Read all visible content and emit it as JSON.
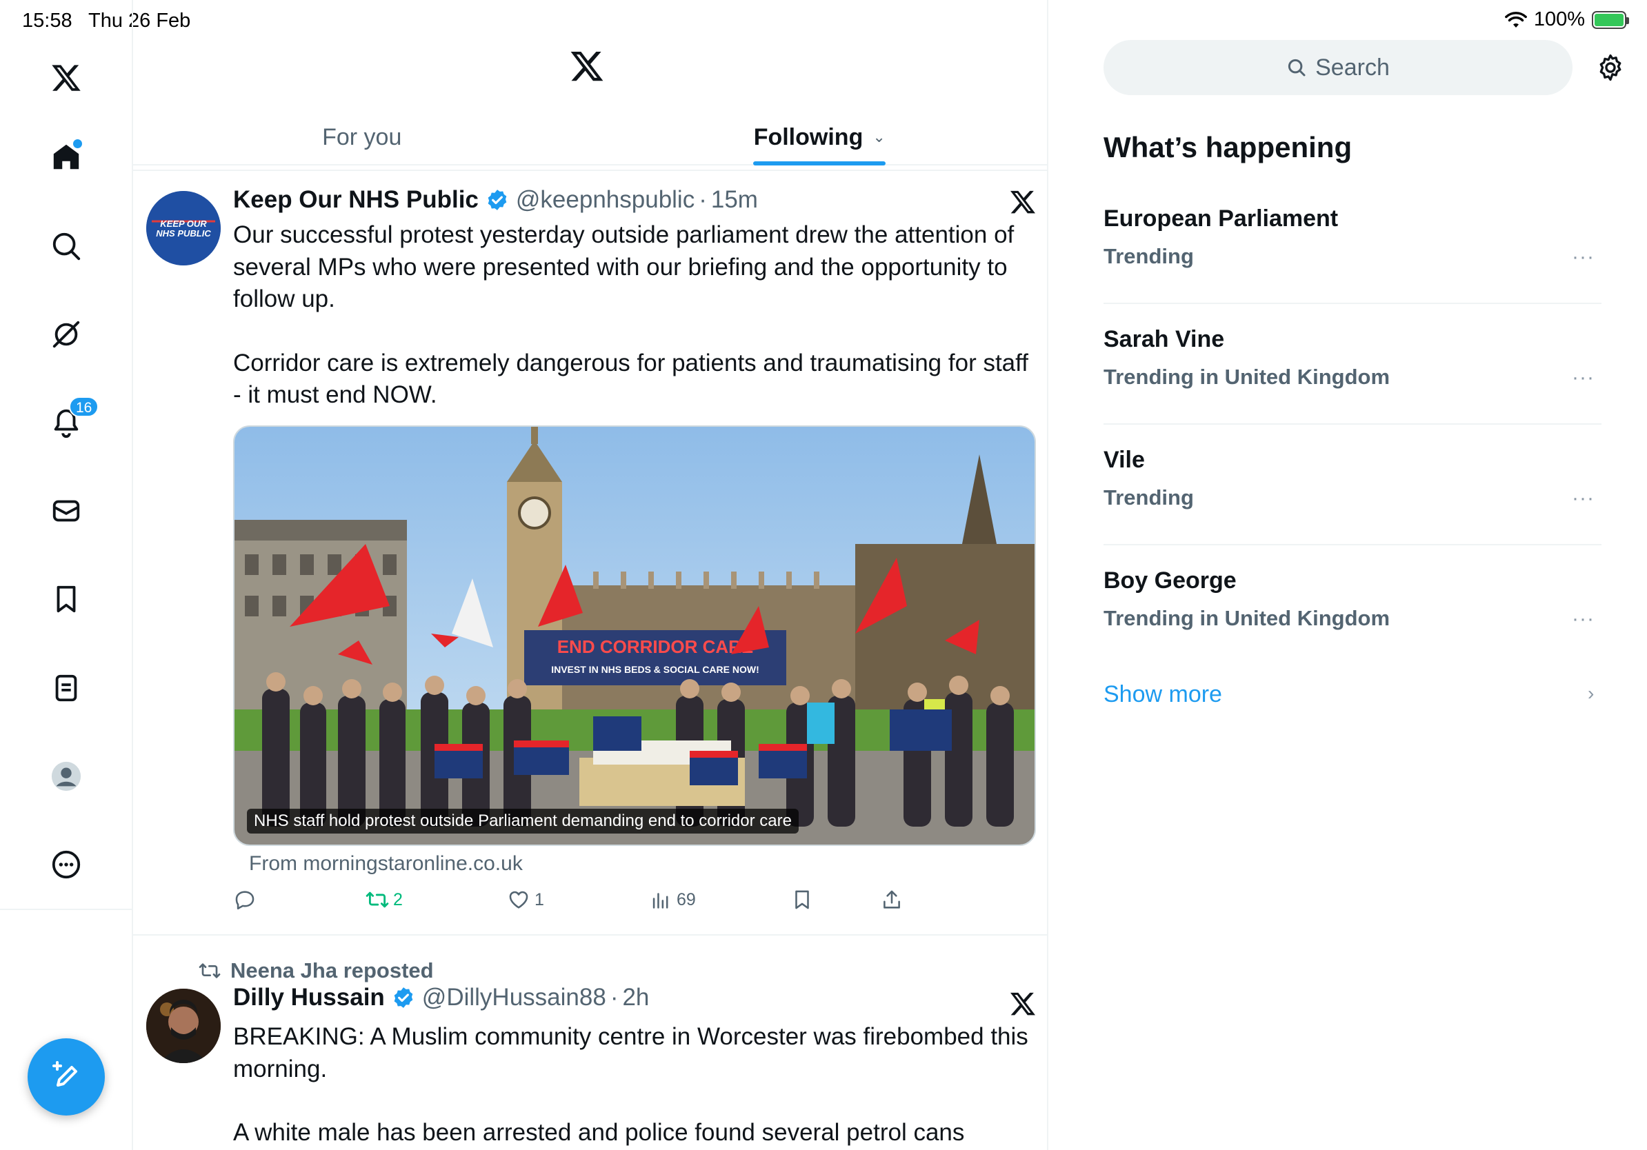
{
  "status_bar": {
    "time": "15:58",
    "date": "Thu 26 Feb",
    "battery": "100%"
  },
  "nav": {
    "notifications_badge": "16",
    "items": [
      "x-logo-icon",
      "home-icon",
      "search-icon",
      "grok-icon",
      "notifications-icon",
      "messages-icon",
      "bookmark-icon",
      "lists-icon",
      "profile-icon",
      "more-icon"
    ]
  },
  "header": {
    "tabs": [
      {
        "label": "For you"
      },
      {
        "label": "Following"
      }
    ]
  },
  "feed": {
    "tweets": [
      {
        "name": "Keep Our NHS Public",
        "handle": "@keepnhspublic",
        "sep": "·",
        "time": "15m",
        "avatar_text": "KEEP OUR NHS PUBLIC",
        "body": [
          "Our successful protest yesterday outside parliament drew the attention of several MPs who were presented with our briefing and the opportunity to follow up.",
          "Corridor care is extremely dangerous for patients and traumatising for staff - it must end NOW."
        ],
        "media_caption": "NHS staff hold protest outside Parliament demanding end to corridor care",
        "banner_text": "END CORRIDOR CARE",
        "banner_sub": "INVEST IN NHS BEDS & SOCIAL CARE NOW!",
        "link_from": "From morningstaronline.co.uk",
        "actions": {
          "replies": "",
          "reposts": "2",
          "likes": "1",
          "views": "69"
        }
      },
      {
        "repost_by": "Neena Jha reposted",
        "name": "Dilly Hussain",
        "handle": "@DillyHussain88",
        "sep": "·",
        "time": "2h",
        "body": [
          "BREAKING: A Muslim community centre in Worcester was firebombed this morning.",
          "A white male has been arrested and police found several petrol cans around"
        ]
      }
    ]
  },
  "sidebar": {
    "search_placeholder": "Search",
    "title": "What’s happening",
    "trends": [
      {
        "name": "European Parliament",
        "meta": "Trending"
      },
      {
        "name": "Sarah Vine",
        "meta": "Trending in United Kingdom"
      },
      {
        "name": "Vile",
        "meta": "Trending"
      },
      {
        "name": "Boy George",
        "meta": "Trending in United Kingdom"
      }
    ],
    "more_label": "···",
    "show_more": "Show more"
  }
}
